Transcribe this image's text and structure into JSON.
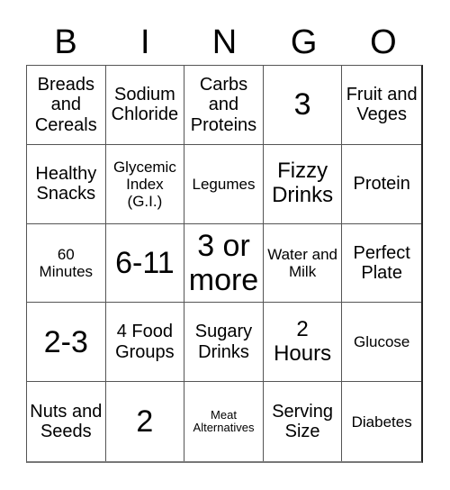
{
  "header": {
    "letters": [
      "B",
      "I",
      "N",
      "G",
      "O"
    ]
  },
  "cells": [
    {
      "text": "Breads and Cereals",
      "size": "md"
    },
    {
      "text": "Sodium Chloride",
      "size": "md"
    },
    {
      "text": "Carbs and Proteins",
      "size": "md"
    },
    {
      "text": "3",
      "size": "xl"
    },
    {
      "text": "Fruit and Veges",
      "size": "md"
    },
    {
      "text": "Healthy Snacks",
      "size": "md"
    },
    {
      "text": "Glycemic Index (G.I.)",
      "size": "sm"
    },
    {
      "text": "Legumes",
      "size": "sm"
    },
    {
      "text": "Fizzy Drinks",
      "size": "lg"
    },
    {
      "text": "Protein",
      "size": "md"
    },
    {
      "text": "60 Minutes",
      "size": "sm"
    },
    {
      "text": "6-11",
      "size": "xl"
    },
    {
      "text": "3 or more",
      "size": "xl"
    },
    {
      "text": "Water and Milk",
      "size": "sm"
    },
    {
      "text": "Perfect Plate",
      "size": "md"
    },
    {
      "text": "2-3",
      "size": "xl"
    },
    {
      "text": "4 Food Groups",
      "size": "md"
    },
    {
      "text": "Sugary Drinks",
      "size": "md"
    },
    {
      "text": "2 Hours",
      "size": "lg"
    },
    {
      "text": "Glucose",
      "size": "sm"
    },
    {
      "text": "Nuts and Seeds",
      "size": "md"
    },
    {
      "text": "2",
      "size": "xl"
    },
    {
      "text": "Meat Alternatives",
      "size": "xs"
    },
    {
      "text": "Serving Size",
      "size": "md"
    },
    {
      "text": "Diabetes",
      "size": "sm"
    }
  ]
}
